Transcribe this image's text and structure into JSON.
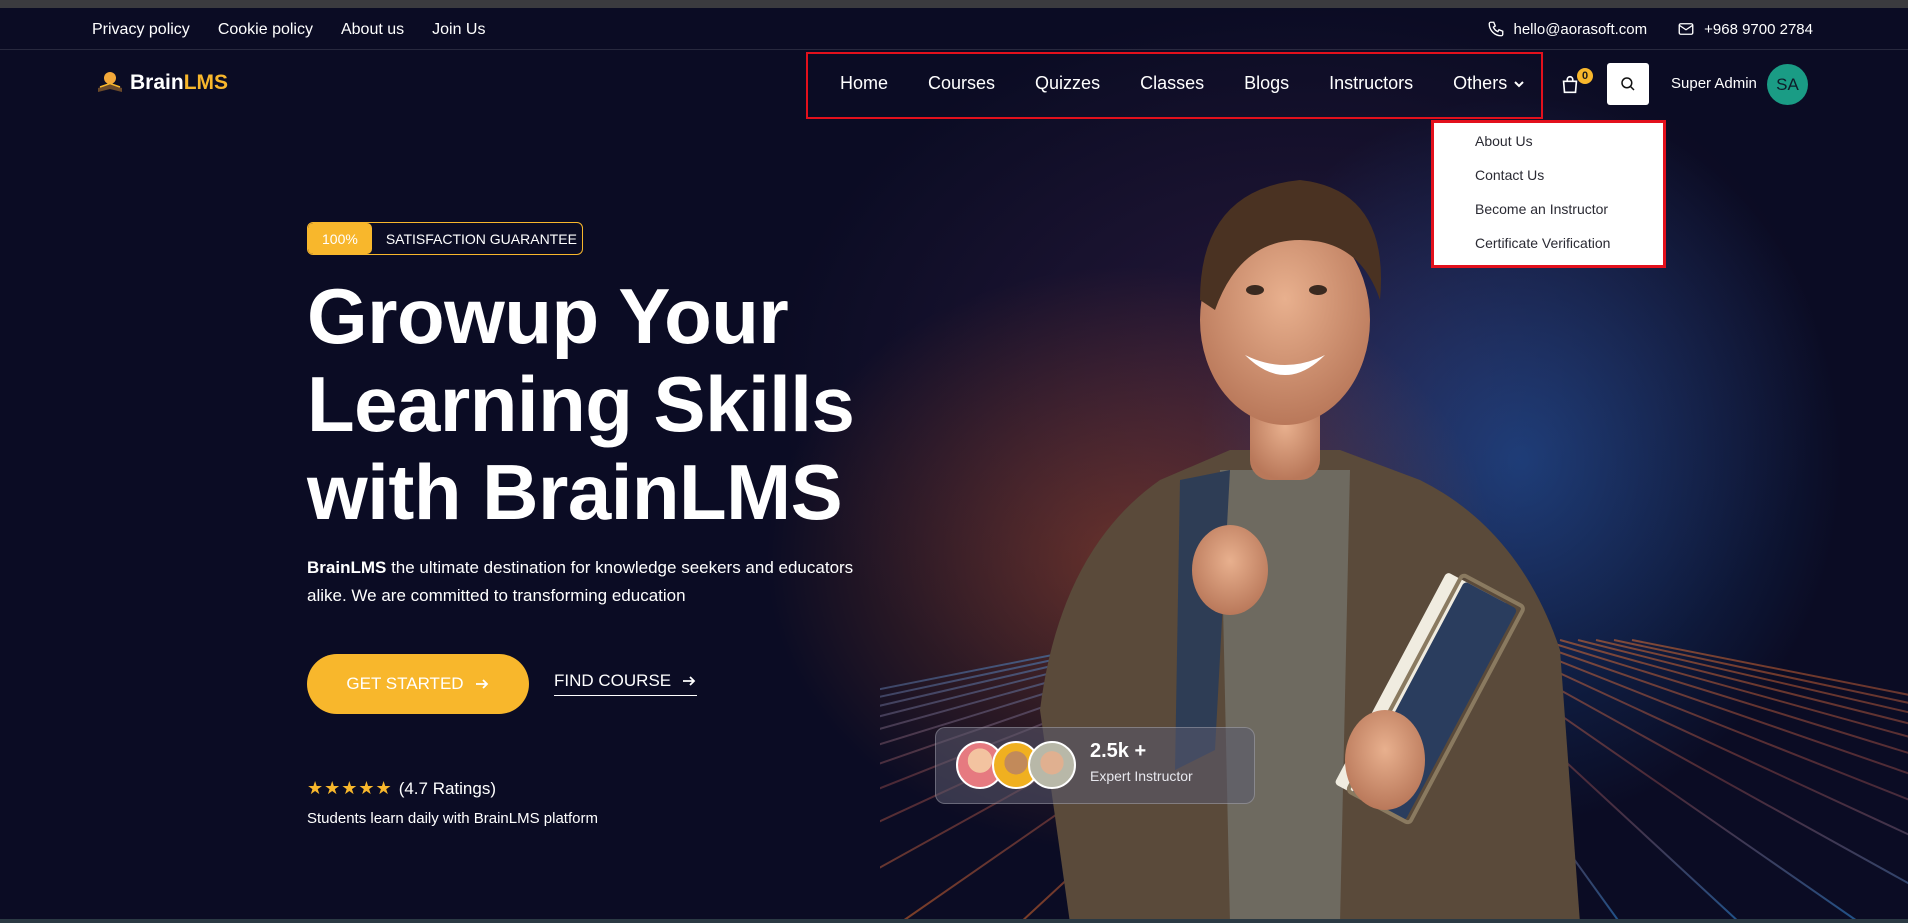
{
  "topbar": {
    "links": [
      "Privacy policy",
      "Cookie policy",
      "About us",
      "Join Us"
    ],
    "email": "hello@aorasoft.com",
    "phone": "+968 9700 2784",
    "icons": {
      "email": "phone-icon",
      "phone": "envelope-icon"
    }
  },
  "logo": {
    "brain": "Brain",
    "lms": "LMS"
  },
  "nav": {
    "items": [
      "Home",
      "Courses",
      "Quizzes",
      "Classes",
      "Blogs",
      "Instructors"
    ],
    "others_label": "Others"
  },
  "cart": {
    "count": "0"
  },
  "user": {
    "name": "Super Admin",
    "initials": "SA"
  },
  "dropdown": {
    "items": [
      "About Us",
      "Contact Us",
      "Become an Instructor",
      "Certificate Verification"
    ]
  },
  "hero": {
    "badge_pct": "100%",
    "badge_text": "SATISFACTION GUARANTEE",
    "title_lines": [
      "Growup Your",
      "Learning Skills",
      "with BrainLMS"
    ],
    "desc_bold": "BrainLMS",
    "desc_rest": " the ultimate destination for knowledge seekers and educators alike. We are committed to transforming education",
    "cta_primary": "GET STARTED",
    "cta_secondary": "FIND COURSE",
    "stars": "★★★★★",
    "ratings": "(4.7 Ratings)",
    "students": "Students learn daily with BrainLMS platform"
  },
  "instructors": {
    "count": "2.5k +",
    "label": "Expert Instructor"
  },
  "colors": {
    "accent": "#f8b72c",
    "background": "#0b0c24",
    "highlight": "#e3101c",
    "avatar": "#1a9c85"
  }
}
